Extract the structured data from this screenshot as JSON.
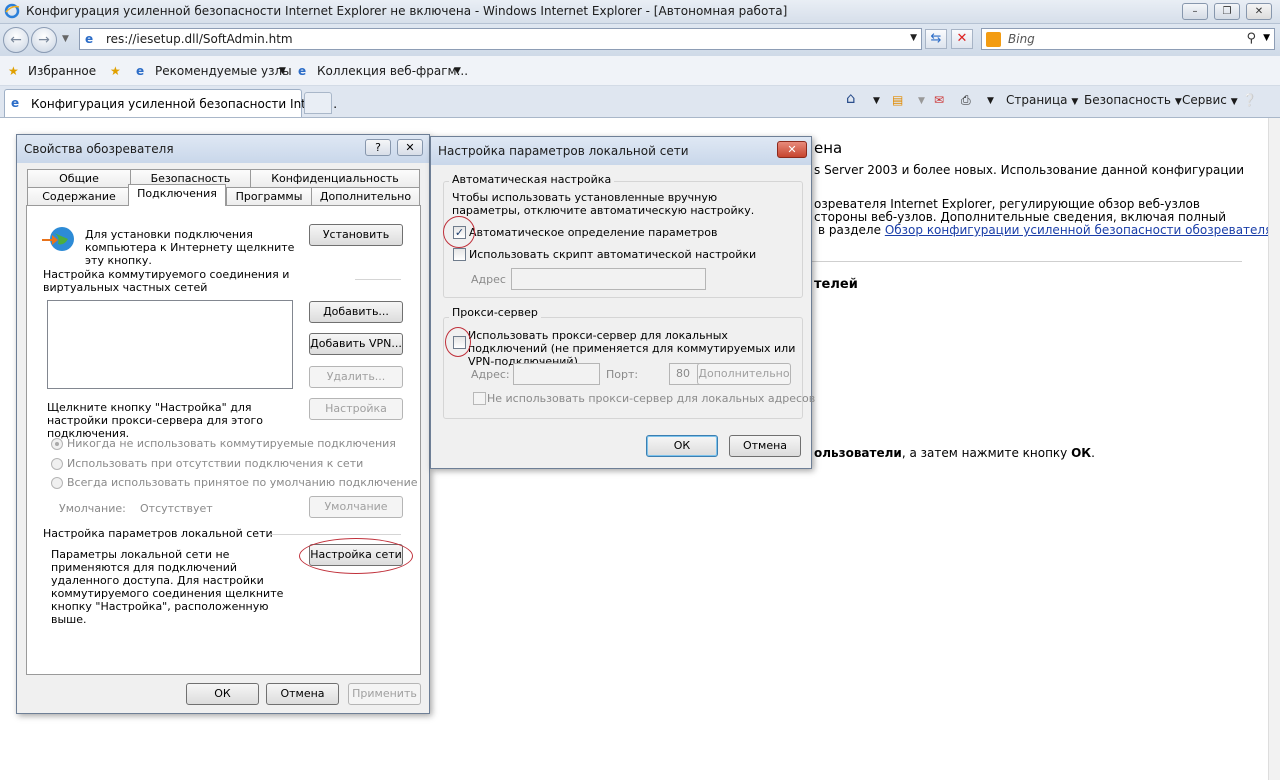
{
  "browser": {
    "window_title": "Конфигурация усиленной безопасности Internet Explorer не включена - Windows Internet Explorer - [Автономная работа]",
    "address": "res://iesetup.dll/SoftAdmin.htm",
    "search_placeholder": "Bing",
    "favorites_label": "Избранное",
    "fav_links": [
      "Рекомендуемые узлы",
      "Коллекция веб-фрагм..."
    ],
    "tab_title": "Конфигурация усиленной безопасности Intern...",
    "commands": {
      "page": "Страница",
      "security": "Безопасность",
      "tools": "Сервис"
    }
  },
  "page": {
    "heading_tail": "ена",
    "line1": "s Server 2003 и более новых. Использование данной конфигурации",
    "line2": "озревателя Internet Explorer, регулирующие обзор веб-узлов",
    "line3": "стороны веб-узлов. Дополнительные сведения, включая полный",
    "line4_prefix": "в разделе",
    "line4_link": "Обзор конфигурации усиленной безопасности обозревателя",
    "subheading_tail": "телей",
    "instruction_bold": "ользователи",
    "instruction_mid": ", а затем нажмите кнопку ",
    "instruction_ok": "ОК",
    "instruction_end": "."
  },
  "inet_dialog": {
    "title": "Свойства обозревателя",
    "tabs_row1": [
      "Общие",
      "Безопасность",
      "Конфиденциальность"
    ],
    "tabs_row2": [
      "Содержание",
      "Подключения",
      "Программы",
      "Дополнительно"
    ],
    "setup_text": "Для установки подключения компьютера к Интернету щелкните эту кнопку.",
    "setup_button": "Установить",
    "dialup_header": "Настройка коммутируемого соединения и виртуальных частных сетей",
    "add_button": "Добавить...",
    "add_vpn_button": "Добавить VPN...",
    "remove_button": "Удалить...",
    "settings_button": "Настройка",
    "proxy_hint": "Щелкните кнопку \"Настройка\" для настройки прокси-сервера для этого подключения.",
    "radio_never": "Никогда не использовать коммутируемые подключения",
    "radio_when_absent": "Использовать при отсутствии подключения к сети",
    "radio_always": "Всегда использовать принятое по умолчанию подключение",
    "default_label": "Умолчание:",
    "default_value": "Отсутствует",
    "default_button": "Умолчание",
    "lan_header": "Настройка параметров локальной сети",
    "lan_text": "Параметры локальной сети не применяются для подключений удаленного доступа. Для настройки коммутируемого соединения щелкните кнопку \"Настройка\", расположенную выше.",
    "lan_button": "Настройка сети",
    "ok": "ОК",
    "cancel": "Отмена",
    "apply": "Применить"
  },
  "lan_dialog": {
    "title": "Настройка параметров локальной сети",
    "auto_group": "Автоматическая настройка",
    "auto_text": "Чтобы использовать установленные вручную параметры, отключите автоматическую настройку.",
    "auto_detect": "Автоматическое определение параметров",
    "auto_detect_checked": true,
    "use_script": "Использовать скрипт автоматической настройки",
    "use_script_checked": false,
    "address_label": "Адрес",
    "proxy_group": "Прокси-сервер",
    "use_proxy": "Использовать прокси-сервер для локальных подключений (не применяется для коммутируемых или VPN-подключений).",
    "use_proxy_checked": false,
    "proxy_address_label": "Адрес:",
    "port_label": "Порт:",
    "port_value": "80",
    "advanced_button": "Дополнительно",
    "bypass_local": "Не использовать прокси-сервер для локальных адресов",
    "ok": "ОК",
    "cancel": "Отмена"
  },
  "colors": {
    "highlight_circle": "#c0313b",
    "link": "#1a3ea8"
  }
}
